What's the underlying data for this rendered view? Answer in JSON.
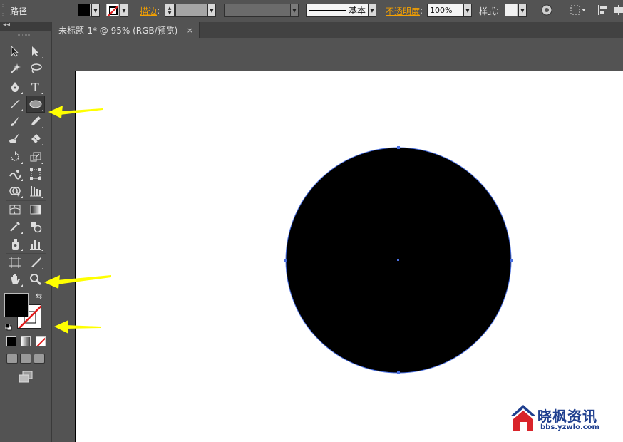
{
  "control_bar": {
    "selection_type": "路径",
    "stroke_label": "描边",
    "stroke_profile": "基本",
    "opacity_label": "不透明度",
    "opacity_value": "100%",
    "style_label": "样式"
  },
  "document_tab": {
    "title": "未标题-1* @ 95% (RGB/预览)",
    "close_glyph": "×"
  },
  "tool_panel": {
    "collapse_glyph": "◂◂",
    "tools": [
      {
        "name": "selection-tool",
        "icon": "arrow"
      },
      {
        "name": "direct-selection-tool",
        "icon": "hollow-arrow"
      },
      {
        "name": "magic-wand-tool",
        "icon": "wand"
      },
      {
        "name": "lasso-tool",
        "icon": "lasso"
      },
      {
        "name": "pen-tool",
        "icon": "pen"
      },
      {
        "name": "type-tool",
        "icon": "T"
      },
      {
        "name": "line-segment-tool",
        "icon": "line"
      },
      {
        "name": "ellipse-tool",
        "icon": "ellipse",
        "selected": true
      },
      {
        "name": "paintbrush-tool",
        "icon": "brush"
      },
      {
        "name": "pencil-tool",
        "icon": "pencil"
      },
      {
        "name": "blob-brush-tool",
        "icon": "blob"
      },
      {
        "name": "eraser-tool",
        "icon": "eraser"
      },
      {
        "name": "rotate-tool",
        "icon": "rotate"
      },
      {
        "name": "scale-tool",
        "icon": "scale"
      },
      {
        "name": "warp-tool",
        "icon": "warp"
      },
      {
        "name": "free-transform-tool",
        "icon": "transform"
      },
      {
        "name": "shape-builder-tool",
        "icon": "shape-builder"
      },
      {
        "name": "perspective-grid-tool",
        "icon": "perspective"
      },
      {
        "name": "mesh-tool",
        "icon": "mesh"
      },
      {
        "name": "gradient-tool",
        "icon": "gradient"
      },
      {
        "name": "eyedropper-tool",
        "icon": "eyedropper"
      },
      {
        "name": "blend-tool",
        "icon": "blend"
      },
      {
        "name": "symbol-sprayer-tool",
        "icon": "spray"
      },
      {
        "name": "column-graph-tool",
        "icon": "graph"
      },
      {
        "name": "artboard-tool",
        "icon": "artboard"
      },
      {
        "name": "slice-tool",
        "icon": "knife"
      },
      {
        "name": "hand-tool",
        "icon": "hand"
      },
      {
        "name": "zoom-tool",
        "icon": "magnifier"
      }
    ]
  },
  "canvas": {
    "shape": "circle",
    "fill": "#000000",
    "selection_color": "#4a6fe0"
  },
  "annotations": {
    "arrow_color": "#ffff00",
    "pointing_to": [
      "ellipse-tool",
      "zoom-tool",
      "fill-stroke-swatches"
    ]
  },
  "watermark": {
    "title": "晓枫资讯",
    "url": "bbs.yzwlo.com",
    "color": "#1f3f8f",
    "accent": "#d9242a"
  }
}
